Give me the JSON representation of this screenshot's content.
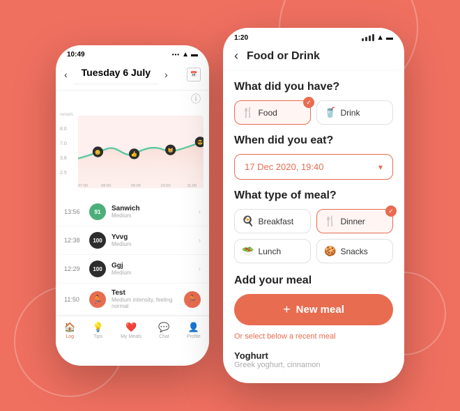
{
  "background": "#f07060",
  "left_phone": {
    "status_time": "10:49",
    "nav": {
      "day": "Tuesday",
      "date": "6 July",
      "prev": "‹",
      "next": "›"
    },
    "chart": {
      "y_label": "mmol/L",
      "y_values": [
        "8.0",
        "7.0",
        "3.8",
        "2.5"
      ],
      "x_values": [
        "07:00",
        "08:00",
        "09:00",
        "10:00",
        "11:00"
      ]
    },
    "entries": [
      {
        "time": "13:56",
        "score": "91",
        "badge_type": "green",
        "name": "Sanwich",
        "sub": "Medium",
        "has_chevron": true
      },
      {
        "time": "12:38",
        "score": "100",
        "badge_type": "dark",
        "name": "Yvvg",
        "sub": "Medium",
        "has_chevron": true
      },
      {
        "time": "12:29",
        "score": "100",
        "badge_type": "dark",
        "name": "Ggj",
        "sub": "Medium",
        "has_chevron": true
      },
      {
        "time": "11:50",
        "score": "~",
        "badge_type": "orange",
        "name": "Test",
        "sub": "Medium intensity, feeling normal",
        "has_chevron": false
      }
    ],
    "bottom_nav": [
      {
        "label": "Log",
        "icon": "🏠",
        "active": true
      },
      {
        "label": "Tips",
        "icon": "💡",
        "active": false
      },
      {
        "label": "My Meals",
        "icon": "❤️",
        "active": false
      },
      {
        "label": "Chat",
        "icon": "💬",
        "active": false
      },
      {
        "label": "Profile",
        "icon": "👤",
        "active": false
      }
    ]
  },
  "right_phone": {
    "status_time": "1:20",
    "back_arrow": "‹",
    "title": "Food or Drink",
    "section1": {
      "heading": "What did you have?",
      "options": [
        {
          "id": "food",
          "label": "Food",
          "icon": "🍴",
          "selected": true
        },
        {
          "id": "drink",
          "label": "Drink",
          "icon": "🥤",
          "selected": false
        }
      ]
    },
    "section2": {
      "heading": "When did you eat?",
      "date_value": "17 Dec 2020, 19:40",
      "chevron": "▾"
    },
    "section3": {
      "heading": "What type of meal?",
      "meal_types": [
        {
          "id": "breakfast",
          "label": "Breakfast",
          "icon": "🍳",
          "selected": false
        },
        {
          "id": "dinner",
          "label": "Dinner",
          "icon": "🍴",
          "selected": true
        },
        {
          "id": "lunch",
          "label": "Lunch",
          "icon": "🥗",
          "selected": false
        },
        {
          "id": "snacks",
          "label": "Snacks",
          "icon": "🍪",
          "selected": false
        }
      ]
    },
    "section4": {
      "heading": "Add your meal",
      "new_meal_label": "New meal",
      "new_meal_plus": "+",
      "or_text": "Or select below a recent meal",
      "recent_meals": [
        {
          "name": "Yoghurt",
          "sub": "Greek yoghurt, cinnamon"
        }
      ]
    }
  }
}
